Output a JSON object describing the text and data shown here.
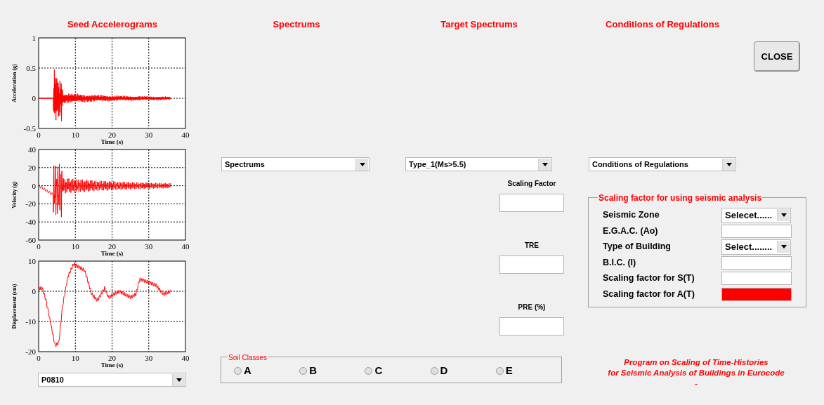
{
  "headings": [
    "Seed Accelerograms",
    "Spectrums",
    "Target Spectrums",
    "Conditions of Regulations"
  ],
  "close_button": "CLOSE",
  "plots": [
    {
      "ylabel": "Acceleration (g)",
      "xlabel": "Time (s)",
      "xticks": [
        "0",
        "10",
        "20",
        "30",
        "40"
      ],
      "yticks": [
        "1",
        "0.5",
        "0",
        "-0.5"
      ]
    },
    {
      "ylabel": "Velocity (g)",
      "xlabel": "Time (s)",
      "xticks": [
        "0",
        "10",
        "20",
        "30",
        "40"
      ],
      "yticks": [
        "40",
        "20",
        "0",
        "-20",
        "-40",
        "-60"
      ]
    },
    {
      "ylabel": "Displacement (cm)",
      "xlabel": "Time (s)",
      "xticks": [
        "0",
        "10",
        "20",
        "30",
        "40"
      ],
      "yticks": [
        "10",
        "0",
        "-10",
        "-20"
      ]
    }
  ],
  "record_select": {
    "value": "P0810"
  },
  "spectrums_select": {
    "value": "Spectrums"
  },
  "target_select": {
    "value": "Type_1(Ms>5.5)"
  },
  "conditions_select": {
    "value": "Conditions of Regulations"
  },
  "result_fields": [
    {
      "label": "Scaling Factor"
    },
    {
      "label": "TRE"
    },
    {
      "label": "PRE (%)"
    }
  ],
  "scaling_panel": {
    "title": "Scaling factor for using seismic analysis",
    "rows": [
      {
        "label": "Seismic Zone",
        "kind": "select",
        "value": "Selecet......"
      },
      {
        "label": "E.G.A.C. (Ao)",
        "kind": "input",
        "highlighted": false
      },
      {
        "label": "Type of Building",
        "kind": "select",
        "value": "Select........"
      },
      {
        "label": "B.I.C. (I)",
        "kind": "input",
        "highlighted": false
      },
      {
        "label": "Scaling factor for S(T)",
        "kind": "input",
        "highlighted": false
      },
      {
        "label": "Scaling factor for A(T)",
        "kind": "input",
        "highlighted": true
      }
    ]
  },
  "soil_classes": {
    "title": "Soil Classes",
    "options": [
      {
        "label": "A",
        "selected": false
      },
      {
        "label": "B",
        "selected": false
      },
      {
        "label": "C",
        "selected": false
      },
      {
        "label": "D",
        "selected": false
      },
      {
        "label": "E",
        "selected": false
      }
    ]
  },
  "program_note": [
    "Program on Scaling of Time-Histories",
    "for Seismic Analysis of Buildings in Eurocode",
    "-"
  ]
}
